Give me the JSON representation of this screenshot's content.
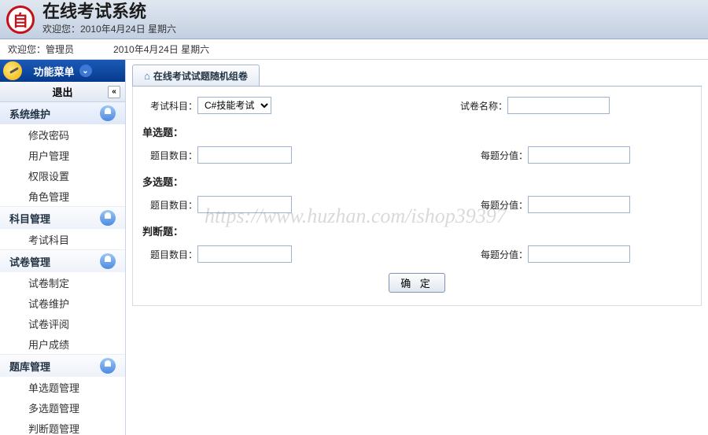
{
  "header": {
    "title": "在线考试系统",
    "subtitle": "欢迎您：2010年4月24日 星期六"
  },
  "welcome": {
    "prefix": "欢迎您：",
    "user": "管理员",
    "date": "2010年4月24日 星期六"
  },
  "sidebar": {
    "menu_label": "功能菜单",
    "exit_label": "退出",
    "collapse_glyph": "«",
    "expand_glyph": "⌄",
    "groups": [
      {
        "title": "系统维护",
        "items": [
          "修改密码",
          "用户管理",
          "权限设置",
          "角色管理"
        ]
      },
      {
        "title": "科目管理",
        "items": [
          "考试科目"
        ]
      },
      {
        "title": "试卷管理",
        "items": [
          "试卷制定",
          "试卷维护",
          "试卷评阅",
          "用户成绩"
        ]
      },
      {
        "title": "题库管理",
        "items": [
          "单选题管理",
          "多选题管理",
          "判断题管理"
        ]
      }
    ]
  },
  "tab": {
    "title": "在线考试试题随机组卷",
    "home_glyph": "⌂"
  },
  "form": {
    "subject_label": "考试科目：",
    "subject_value": "C#技能考试",
    "paper_name_label": "试卷名称：",
    "single_section": "单选题：",
    "multi_section": "多选题：",
    "judge_section": "判断题：",
    "count_label": "题目数目：",
    "score_label": "每题分值：",
    "submit": "确 定"
  },
  "watermark": "https://www.huzhan.com/ishop39397"
}
